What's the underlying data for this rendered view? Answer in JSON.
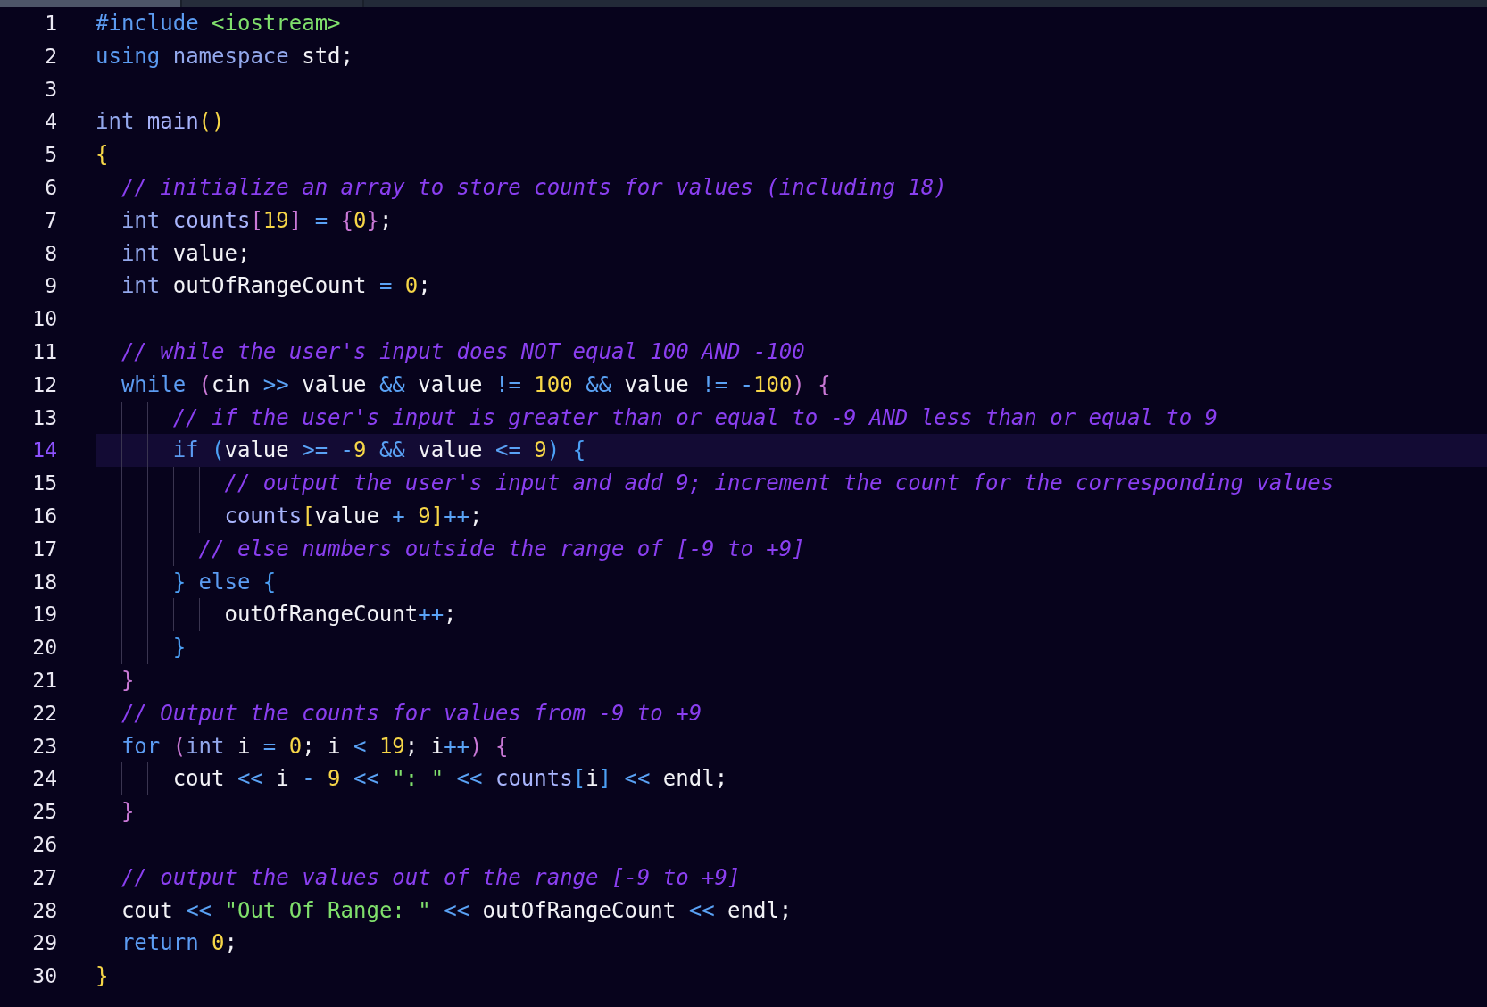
{
  "tabs": [
    {
      "selected": true
    },
    {
      "selected": false
    }
  ],
  "editor": {
    "lines": [
      {
        "number": "1",
        "active": false,
        "tokens": [
          {
            "kind": "keyword",
            "text": "#include "
          },
          {
            "kind": "string",
            "text": "<iostream>"
          }
        ]
      },
      {
        "number": "2",
        "active": false,
        "tokens": [
          {
            "kind": "keyword",
            "text": "using "
          },
          {
            "kind": "type",
            "text": "namespace "
          },
          {
            "kind": "plain",
            "text": "std;"
          }
        ]
      },
      {
        "number": "3",
        "active": false
      },
      {
        "number": "4",
        "active": false,
        "tokens": [
          {
            "kind": "type",
            "text": "int "
          },
          {
            "kind": "name",
            "text": "main"
          },
          {
            "kind": "gold",
            "text": "()"
          }
        ]
      },
      {
        "number": "5",
        "active": false,
        "tokens": [
          {
            "kind": "gold",
            "text": "{"
          }
        ]
      },
      {
        "number": "6",
        "active": false,
        "tokens": [
          {
            "kind": "comment",
            "text": "  // initialize an array to store counts for values (including 18)"
          }
        ]
      },
      {
        "number": "7",
        "active": false,
        "tokens": [
          {
            "kind": "type",
            "text": "  int "
          },
          {
            "kind": "name",
            "text": "counts"
          },
          {
            "kind": "pink",
            "text": "["
          },
          {
            "kind": "number",
            "text": "19"
          },
          {
            "kind": "pink",
            "text": "]"
          },
          {
            "kind": "operator",
            "text": " = "
          },
          {
            "kind": "pink",
            "text": "{"
          },
          {
            "kind": "number",
            "text": "0"
          },
          {
            "kind": "pink",
            "text": "}"
          },
          {
            "kind": "plain",
            "text": ";"
          }
        ]
      },
      {
        "number": "8",
        "active": false,
        "tokens": [
          {
            "kind": "type",
            "text": "  int "
          },
          {
            "kind": "plain",
            "text": "value;"
          }
        ]
      },
      {
        "number": "9",
        "active": false,
        "tokens": [
          {
            "kind": "type",
            "text": "  int "
          },
          {
            "kind": "plain",
            "text": "outOfRangeCount "
          },
          {
            "kind": "operator",
            "text": "= "
          },
          {
            "kind": "number",
            "text": "0"
          },
          {
            "kind": "plain",
            "text": ";"
          }
        ]
      },
      {
        "number": "10",
        "active": false
      },
      {
        "number": "11",
        "active": false,
        "tokens": [
          {
            "kind": "comment",
            "text": "  // while the user's input does NOT equal 100 AND -100"
          }
        ]
      },
      {
        "number": "12",
        "active": false,
        "tokens": [
          {
            "kind": "keyword",
            "text": "  while "
          },
          {
            "kind": "pink",
            "text": "("
          },
          {
            "kind": "plain",
            "text": "cin "
          },
          {
            "kind": "operator",
            "text": ">> "
          },
          {
            "kind": "plain",
            "text": "value "
          },
          {
            "kind": "operator",
            "text": "&& "
          },
          {
            "kind": "plain",
            "text": "value "
          },
          {
            "kind": "operator",
            "text": "!= "
          },
          {
            "kind": "number",
            "text": "100 "
          },
          {
            "kind": "operator",
            "text": "&& "
          },
          {
            "kind": "plain",
            "text": "value "
          },
          {
            "kind": "operator",
            "text": "!= -"
          },
          {
            "kind": "number",
            "text": "100"
          },
          {
            "kind": "pink",
            "text": ") "
          },
          {
            "kind": "pink",
            "text": "{"
          }
        ]
      },
      {
        "number": "13",
        "active": false,
        "tokens": [
          {
            "kind": "comment",
            "text": "      // if the user's input is greater than or equal to -9 AND less than or equal to 9"
          }
        ]
      },
      {
        "number": "14",
        "active": true,
        "tokens": [
          {
            "kind": "keyword",
            "text": "      if "
          },
          {
            "kind": "blue",
            "text": "("
          },
          {
            "kind": "plain",
            "text": "value "
          },
          {
            "kind": "operator",
            "text": ">= -"
          },
          {
            "kind": "number",
            "text": "9 "
          },
          {
            "kind": "operator",
            "text": "&& "
          },
          {
            "kind": "plain",
            "text": "value "
          },
          {
            "kind": "operator",
            "text": "<= "
          },
          {
            "kind": "number",
            "text": "9"
          },
          {
            "kind": "blue",
            "text": ") "
          },
          {
            "kind": "blue",
            "text": "{"
          }
        ]
      },
      {
        "number": "15",
        "active": false,
        "tokens": [
          {
            "kind": "comment",
            "text": "          // output the user's input and add 9; increment the count for the corresponding values"
          }
        ]
      },
      {
        "number": "16",
        "active": false,
        "tokens": [
          {
            "kind": "name",
            "text": "          counts"
          },
          {
            "kind": "gold",
            "text": "["
          },
          {
            "kind": "plain",
            "text": "value "
          },
          {
            "kind": "operator",
            "text": "+ "
          },
          {
            "kind": "number",
            "text": "9"
          },
          {
            "kind": "gold",
            "text": "]"
          },
          {
            "kind": "operator",
            "text": "++"
          },
          {
            "kind": "plain",
            "text": ";"
          }
        ]
      },
      {
        "number": "17",
        "active": false,
        "tokens": [
          {
            "kind": "comment",
            "text": "        // else numbers outside the range of [-9 to +9]"
          }
        ]
      },
      {
        "number": "18",
        "active": false,
        "tokens": [
          {
            "kind": "blue",
            "text": "      } "
          },
          {
            "kind": "keyword",
            "text": "else "
          },
          {
            "kind": "blue",
            "text": "{"
          }
        ]
      },
      {
        "number": "19",
        "active": false,
        "tokens": [
          {
            "kind": "plain",
            "text": "          outOfRangeCount"
          },
          {
            "kind": "operator",
            "text": "++"
          },
          {
            "kind": "plain",
            "text": ";"
          }
        ]
      },
      {
        "number": "20",
        "active": false,
        "tokens": [
          {
            "kind": "blue",
            "text": "      }"
          }
        ]
      },
      {
        "number": "21",
        "active": false,
        "tokens": [
          {
            "kind": "pink",
            "text": "  }"
          }
        ]
      },
      {
        "number": "22",
        "active": false,
        "tokens": [
          {
            "kind": "comment",
            "text": "  // Output the counts for values from -9 to +9"
          }
        ]
      },
      {
        "number": "23",
        "active": false,
        "tokens": [
          {
            "kind": "keyword",
            "text": "  for "
          },
          {
            "kind": "pink",
            "text": "("
          },
          {
            "kind": "type",
            "text": "int "
          },
          {
            "kind": "plain",
            "text": "i "
          },
          {
            "kind": "operator",
            "text": "= "
          },
          {
            "kind": "number",
            "text": "0"
          },
          {
            "kind": "plain",
            "text": "; i "
          },
          {
            "kind": "operator",
            "text": "< "
          },
          {
            "kind": "number",
            "text": "19"
          },
          {
            "kind": "plain",
            "text": "; i"
          },
          {
            "kind": "operator",
            "text": "++"
          },
          {
            "kind": "pink",
            "text": ") "
          },
          {
            "kind": "pink",
            "text": "{"
          }
        ]
      },
      {
        "number": "24",
        "active": false,
        "tokens": [
          {
            "kind": "plain",
            "text": "      cout "
          },
          {
            "kind": "operator",
            "text": "<< "
          },
          {
            "kind": "plain",
            "text": "i "
          },
          {
            "kind": "operator",
            "text": "- "
          },
          {
            "kind": "number",
            "text": "9 "
          },
          {
            "kind": "operator",
            "text": "<< "
          },
          {
            "kind": "string",
            "text": "\": \" "
          },
          {
            "kind": "operator",
            "text": "<< "
          },
          {
            "kind": "name",
            "text": "counts"
          },
          {
            "kind": "blue",
            "text": "["
          },
          {
            "kind": "plain",
            "text": "i"
          },
          {
            "kind": "blue",
            "text": "] "
          },
          {
            "kind": "operator",
            "text": "<< "
          },
          {
            "kind": "plain",
            "text": "endl;"
          }
        ]
      },
      {
        "number": "25",
        "active": false,
        "tokens": [
          {
            "kind": "pink",
            "text": "  }"
          }
        ]
      },
      {
        "number": "26",
        "active": false
      },
      {
        "number": "27",
        "active": false,
        "tokens": [
          {
            "kind": "comment",
            "text": "  // output the values out of the range [-9 to +9]"
          }
        ]
      },
      {
        "number": "28",
        "active": false,
        "tokens": [
          {
            "kind": "plain",
            "text": "  cout "
          },
          {
            "kind": "operator",
            "text": "<< "
          },
          {
            "kind": "string",
            "text": "\"Out Of Range: \" "
          },
          {
            "kind": "operator",
            "text": "<< "
          },
          {
            "kind": "plain",
            "text": "outOfRangeCount "
          },
          {
            "kind": "operator",
            "text": "<< "
          },
          {
            "kind": "plain",
            "text": "endl;"
          }
        ]
      },
      {
        "number": "29",
        "active": false,
        "tokens": [
          {
            "kind": "keyword",
            "text": "  return "
          },
          {
            "kind": "number",
            "text": "0"
          },
          {
            "kind": "plain",
            "text": ";"
          }
        ]
      },
      {
        "number": "30",
        "active": false,
        "tokens": [
          {
            "kind": "gold",
            "text": "}"
          }
        ]
      }
    ]
  }
}
